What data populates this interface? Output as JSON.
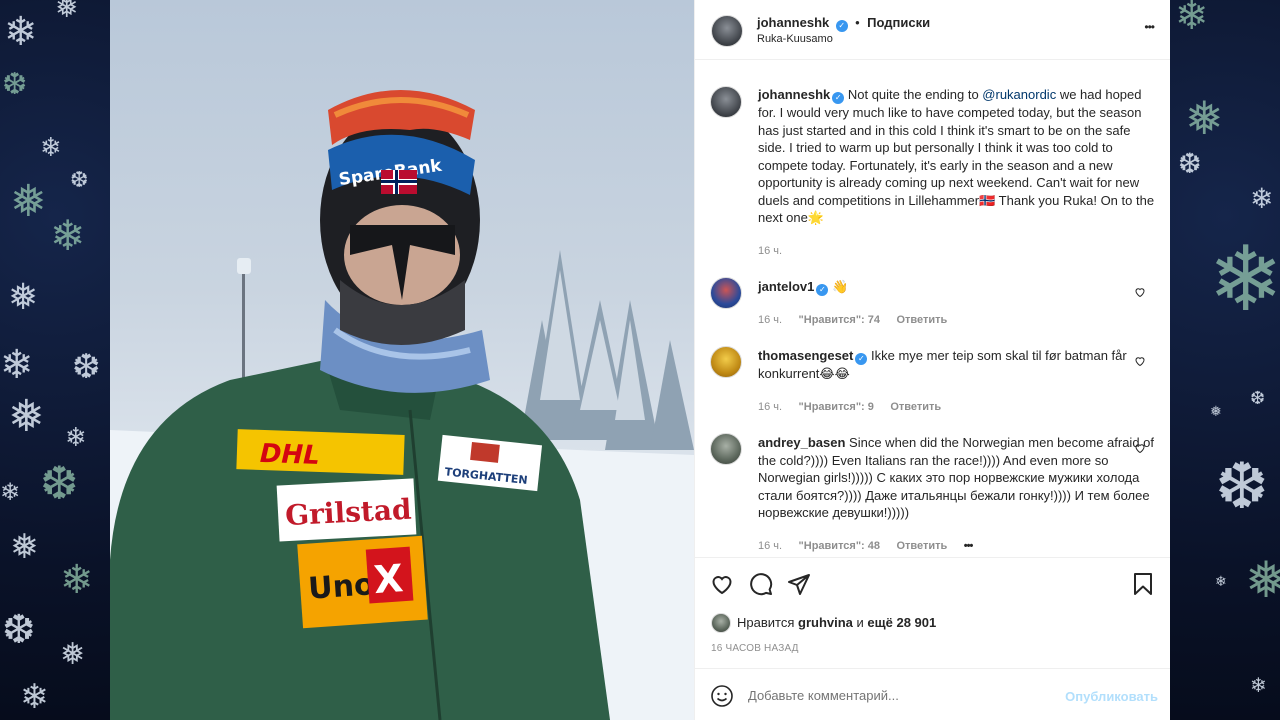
{
  "post": {
    "username": "johanneshk",
    "separator": "•",
    "follow_label": "Подписки",
    "location": "Ruka-Kuusamo",
    "more_label": "•••"
  },
  "caption": {
    "username": "johanneshk",
    "text_before": " Not quite the ending to ",
    "mention": "@rukanordic",
    "text_after": " we had hoped for. I would very much like to have competed today, but the season has just started and in this cold I think it's smart to be on the safe side. I tried to warm up but personally I think it was too cold to compete today. Fortunately, it's early in the season and a new opportunity is already coming up next weekend. Can't wait for new duels and competitions in Lillehammer🇳🇴 Thank you Ruka! On to the next one🌟",
    "time": "16 ч."
  },
  "comments": [
    {
      "username": "jantelov1",
      "text": " 👋",
      "time": "16 ч.",
      "likes": "\"Нравится\": 74",
      "reply": "Ответить",
      "more": ""
    },
    {
      "username": "thomasengeset",
      "text": " Ikke mye mer teip som skal til før batman får konkurrent😂😂",
      "time": "16 ч.",
      "likes": "\"Нравится\": 9",
      "reply": "Ответить",
      "more": ""
    },
    {
      "username": "andrey_basen",
      "text": " Since when did the Norwegian men become afraid of the cold?)))) Even Italians ran the race!)))) And even more so Norwegian girls!))))) С каких это пор норвежские мужики холода стали боятся?)))) Даже итальянцы бежали гонку!)))) И тем более норвежские девушки!)))))",
      "time": "16 ч.",
      "likes": "\"Нравится\": 48",
      "reply": "Ответить",
      "more": "•••"
    }
  ],
  "likes": {
    "prefix": "Нравится",
    "user": "gruhvina",
    "middle": "и",
    "rest": "ещё 28 901"
  },
  "timestamp": "16 ЧАСОВ НАЗАД",
  "add_comment": {
    "placeholder": "Добавьте комментарий...",
    "publish_label": "Опубликовать"
  },
  "photo": {
    "sponsor_dhl": "DHL",
    "sponsor_grilstad": "Grilstad",
    "sponsor_uno": "Uno",
    "sponsor_uno_x": "X",
    "sponsor_torghatten": "TORGHATTEN",
    "headband_text": "SpareBank"
  },
  "icons": {
    "heart": "heart-icon",
    "comment": "comment-icon",
    "share": "share-icon",
    "save": "bookmark-icon",
    "emoji": "emoji-icon"
  },
  "colors": {
    "verified": "#3897f0",
    "publish": "#b2dffc",
    "jacket": "#2f5f48"
  }
}
